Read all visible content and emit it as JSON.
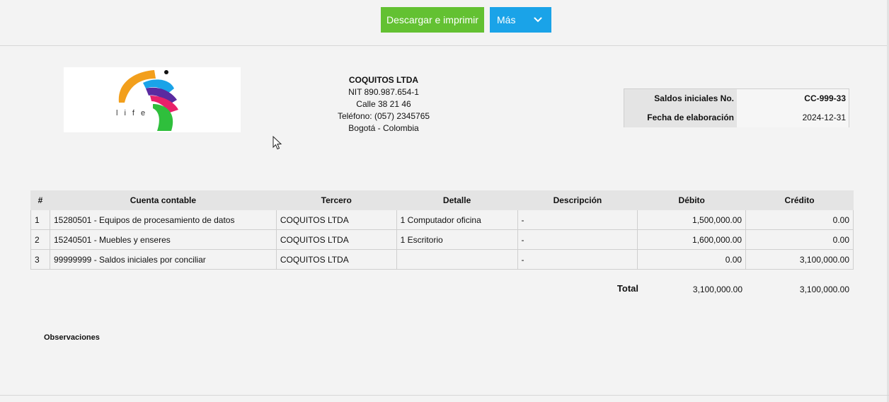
{
  "toolbar": {
    "print_label": "Descargar e imprimir",
    "more_label": "Más"
  },
  "company": {
    "name": "COQUITOS LTDA",
    "nit": "NIT 890.987.654-1",
    "address": "Calle 38 21 46",
    "phone": "Teléfono: (057) 2345765",
    "city": "Bogotá - Colombia",
    "logo_text": "life"
  },
  "document": {
    "number_label": "Saldos iniciales No.",
    "number_value": "CC-999-33",
    "date_label": "Fecha de elaboración",
    "date_value": "2024-12-31"
  },
  "table": {
    "headers": [
      "#",
      "Cuenta contable",
      "Tercero",
      "Detalle",
      "Descripción",
      "Débito",
      "Crédito"
    ],
    "rows": [
      [
        "1",
        "15280501 - Equipos de procesamiento de datos",
        "COQUITOS LTDA",
        "1 Computador oficina",
        "-",
        "1,500,000.00",
        "0.00"
      ],
      [
        "2",
        "15240501 - Muebles y enseres",
        "COQUITOS LTDA",
        "1 Escritorio",
        "-",
        "1,600,000.00",
        "0.00"
      ],
      [
        "3",
        "99999999 - Saldos iniciales por conciliar",
        "COQUITOS LTDA",
        "",
        "-",
        "0.00",
        "3,100,000.00"
      ]
    ]
  },
  "totals": {
    "label": "Total",
    "debit": "3,100,000.00",
    "credit": "3,100,000.00"
  },
  "observations_label": "Observaciones",
  "colors": {
    "print_button": "#63c132",
    "more_button": "#1aa3e8"
  }
}
